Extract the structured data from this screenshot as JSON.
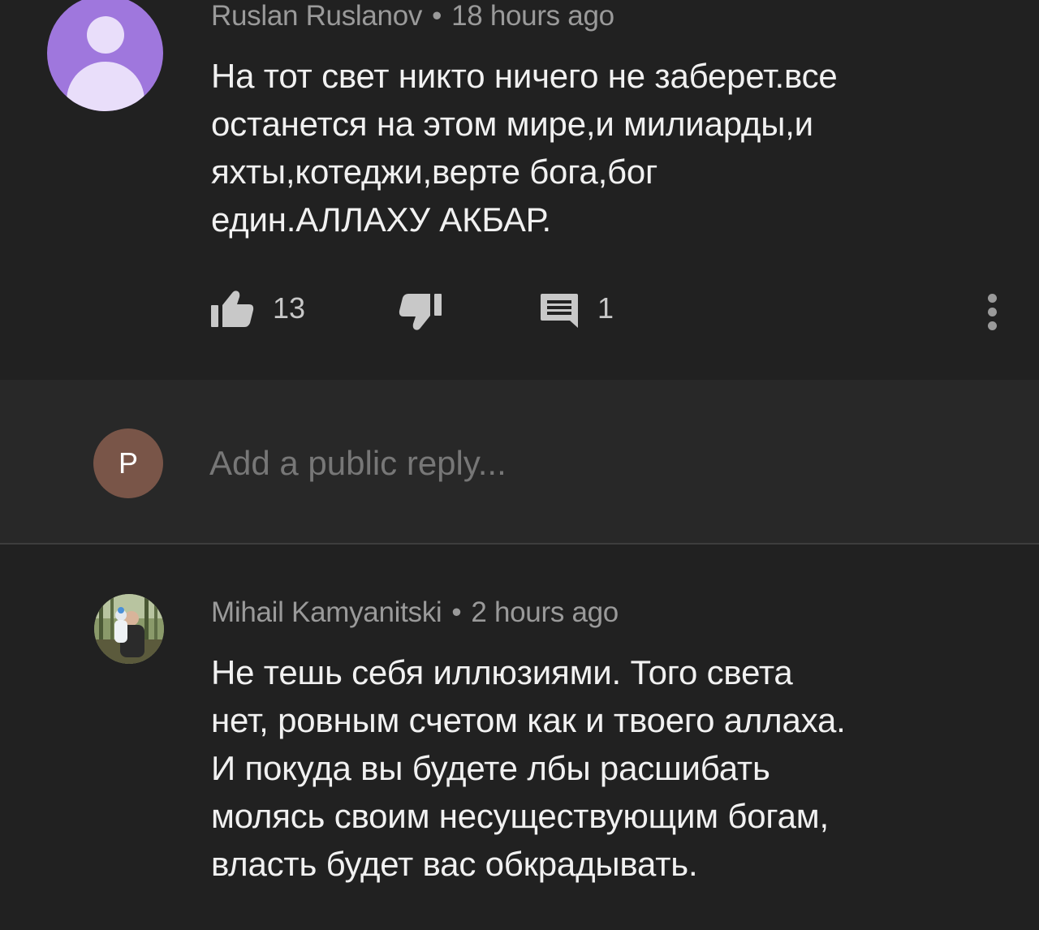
{
  "comments": [
    {
      "author": "Ruslan Ruslanov",
      "separator": "•",
      "time": "18 hours ago",
      "lines": [
        "На тот свет никто ничего не заберет.все",
        "останется на этом мире,и милиарды,и",
        "яхты,котеджи,верте бога,бог",
        "един.АЛЛАХУ АКБАР."
      ],
      "likes": "13",
      "replies": "1",
      "avatar_color": "#9f77dd"
    },
    {
      "author": "Mihail Kamyanitski",
      "separator": "•",
      "time": "2 hours ago",
      "lines": [
        "Не тешь себя иллюзиями. Того света",
        "нет, ровным счетом как и твоего аллаха.",
        "И покуда вы будете лбы расшибать",
        "молясь своим несуществующим богам,",
        "власть будет вас обкрадывать."
      ]
    }
  ],
  "reply": {
    "avatar_letter": "P",
    "avatar_color": "#795548",
    "placeholder": "Add a public reply..."
  },
  "icons": {
    "like": "thumbs-up-icon",
    "dislike": "thumbs-down-icon",
    "reply": "comment-icon",
    "more": "more-vertical-icon"
  },
  "colors": {
    "comment_bg": "#212121",
    "reply_bg": "#282828",
    "meta_text": "#9a9a9a",
    "body_text": "#f1f1f1"
  }
}
